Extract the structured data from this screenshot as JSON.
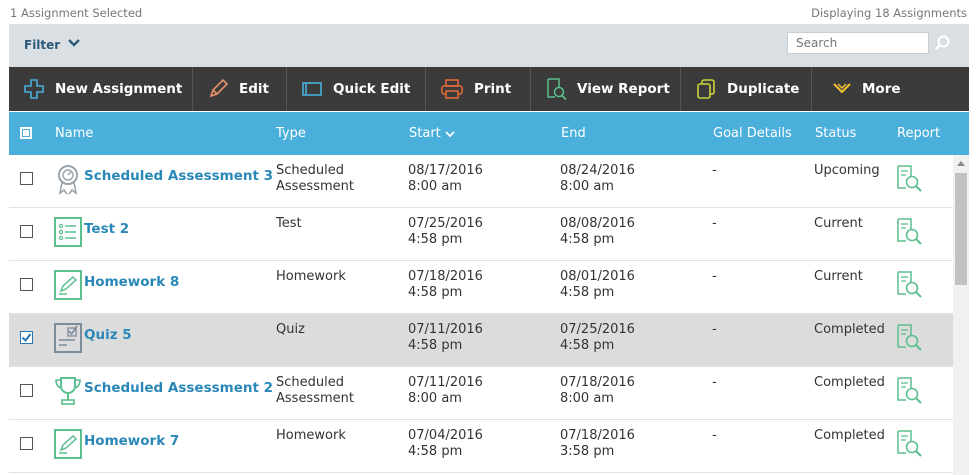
{
  "status": {
    "selected_text": "1 Assignment Selected",
    "display_text": "Displaying 18 Assignments"
  },
  "filter": {
    "label": "Filter",
    "search_placeholder": "Search"
  },
  "toolbar": {
    "new_assignment": "New Assignment",
    "edit": "Edit",
    "quick_edit": "Quick Edit",
    "print": "Print",
    "view_report": "View Report",
    "duplicate": "Duplicate",
    "more": "More"
  },
  "columns": {
    "name": "Name",
    "type": "Type",
    "start": "Start",
    "end": "End",
    "goal": "Goal Details",
    "status": "Status",
    "report": "Report"
  },
  "colors": {
    "header_bg": "#4bafdc",
    "toolbar_bg": "#3b3b3b",
    "filter_bg": "#d9dfe3",
    "link": "#2a88b8",
    "icon_green": "#5cbf8e",
    "selected_row": "#dcdcdc"
  },
  "rows": [
    {
      "icon": "award-ribbon-icon",
      "name": "Scheduled Assessment 3",
      "type": "Scheduled\nAssessment",
      "start_date": "08/17/2016",
      "start_time": "8:00 am",
      "end_date": "08/24/2016",
      "end_time": "8:00 am",
      "goal": "-",
      "status": "Upcoming",
      "checked": false
    },
    {
      "icon": "test-list-icon",
      "name": "Test 2",
      "type": "Test",
      "start_date": "07/25/2016",
      "start_time": "4:58 pm",
      "end_date": "08/08/2016",
      "end_time": "4:58 pm",
      "goal": "-",
      "status": "Current",
      "checked": false
    },
    {
      "icon": "homework-pencil-icon",
      "name": "Homework 8",
      "type": "Homework",
      "start_date": "07/18/2016",
      "start_time": "4:58 pm",
      "end_date": "08/01/2016",
      "end_time": "4:58 pm",
      "goal": "-",
      "status": "Current",
      "checked": false
    },
    {
      "icon": "quiz-check-icon",
      "name": "Quiz 5",
      "type": "Quiz",
      "start_date": "07/11/2016",
      "start_time": "4:58 pm",
      "end_date": "07/25/2016",
      "end_time": "4:58 pm",
      "goal": "-",
      "status": "Completed",
      "checked": true
    },
    {
      "icon": "trophy-icon",
      "name": "Scheduled Assessment 2",
      "type": "Scheduled\nAssessment",
      "start_date": "07/11/2016",
      "start_time": "8:00 am",
      "end_date": "07/18/2016",
      "end_time": "8:00 am",
      "goal": "-",
      "status": "Completed",
      "checked": false
    },
    {
      "icon": "homework-pencil-icon",
      "name": "Homework 7",
      "type": "Homework",
      "start_date": "07/04/2016",
      "start_time": "4:58 pm",
      "end_date": "07/18/2016",
      "end_time": "3:58 pm",
      "goal": "-",
      "status": "Completed",
      "checked": false
    }
  ]
}
